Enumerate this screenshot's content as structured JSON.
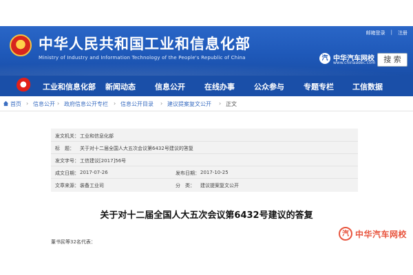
{
  "header": {
    "org_title": "中华人民共和国工业和信息化部",
    "org_en": "Ministry of Industry and Information Technology of the People's Republic of China",
    "top_links": [
      "邮箱登录",
      "|",
      "注册"
    ],
    "search_label": "搜 索",
    "watermark": {
      "badge": "汽",
      "name": "中华汽车网校",
      "url": "www.chinaadec.com"
    }
  },
  "nav": {
    "items": [
      "工业和信息化部",
      "新闻动态",
      "信息公开",
      "在线办事",
      "公众参与",
      "专题专栏",
      "工信数据"
    ]
  },
  "breadcrumb": {
    "items": [
      "首页",
      "信息公开",
      "政府信息公开专栏",
      "信息公开目录",
      "建议提案复文公开",
      "正文"
    ],
    "separator": "›"
  },
  "doc_info": {
    "issuer_label": "发文机关：",
    "issuer": "工业和信息化部",
    "title_label": "标　题：",
    "title_value": "关于对十二届全国人大五次会议第6432号建议的答复",
    "doc_no_label": "发文字号：",
    "doc_no": "工信建议[2017]56号",
    "created_label": "成文日期：",
    "created": "2017-07-26",
    "published_label": "发布日期：",
    "published": "2017-10-25",
    "source_label": "文章来源：",
    "source": "装备工业司",
    "category_label": "分　类：",
    "category": "建议提案复文公开"
  },
  "document": {
    "title": "关于对十二届全国人大五次会议第6432号建议的答复",
    "salutation": "董书民等32名代表："
  },
  "bottom_watermark": {
    "ring": "汽",
    "text": "中华汽车网校"
  },
  "colors": {
    "banner": "#1e58b8",
    "nav": "#1a4fa8",
    "link": "#3c6fc2",
    "watermark_red": "#e8543d"
  }
}
